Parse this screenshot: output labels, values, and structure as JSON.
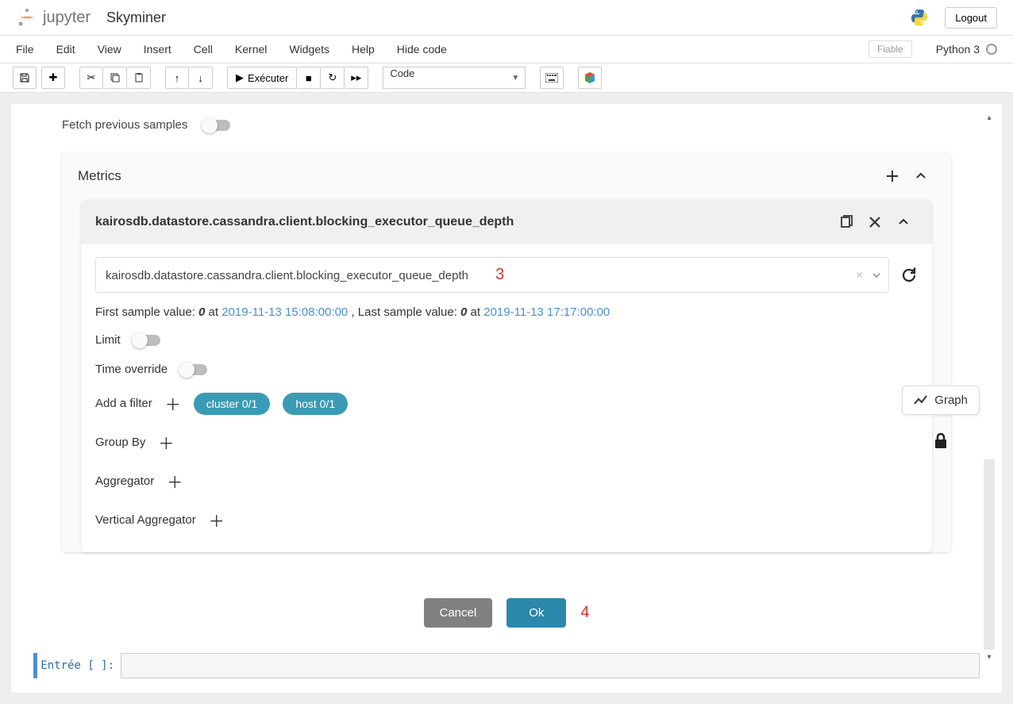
{
  "header": {
    "logo_text": "jupyter",
    "notebook_name": "Skyminer",
    "logout": "Logout"
  },
  "menu": {
    "items": [
      "File",
      "Edit",
      "View",
      "Insert",
      "Cell",
      "Kernel",
      "Widgets",
      "Help",
      "Hide code"
    ],
    "trust": "Fiable",
    "kernel": "Python 3"
  },
  "toolbar": {
    "run_label": "Exécuter",
    "cell_type": "Code"
  },
  "widget": {
    "fetch_prev": "Fetch previous samples",
    "metrics_title": "Metrics",
    "metric_name": "kairosdb.datastore.cassandra.client.blocking_executor_queue_depth",
    "metric_select_value": "kairosdb.datastore.cassandra.client.blocking_executor_queue_depth",
    "sample": {
      "first_label": "First sample value: ",
      "first_val": "0",
      "at": " at ",
      "first_time": "2019-11-13 15:08:00:00",
      "sep": " ,   ",
      "last_label": "Last sample value: ",
      "last_val": "0",
      "last_time": "2019-11-13 17:17:00:00"
    },
    "limit": "Limit",
    "time_override": "Time override",
    "add_filter": "Add a filter",
    "filter_chips": {
      "cluster": "cluster 0/1",
      "host": "host 0/1"
    },
    "group_by": "Group By",
    "aggregator": "Aggregator",
    "vertical_agg": "Vertical Aggregator"
  },
  "buttons": {
    "cancel": "Cancel",
    "ok": "Ok"
  },
  "side": {
    "graph": "Graph"
  },
  "cell": {
    "prompt": "Entrée [ ]:"
  },
  "annotations": {
    "three": "3",
    "four": "4"
  }
}
